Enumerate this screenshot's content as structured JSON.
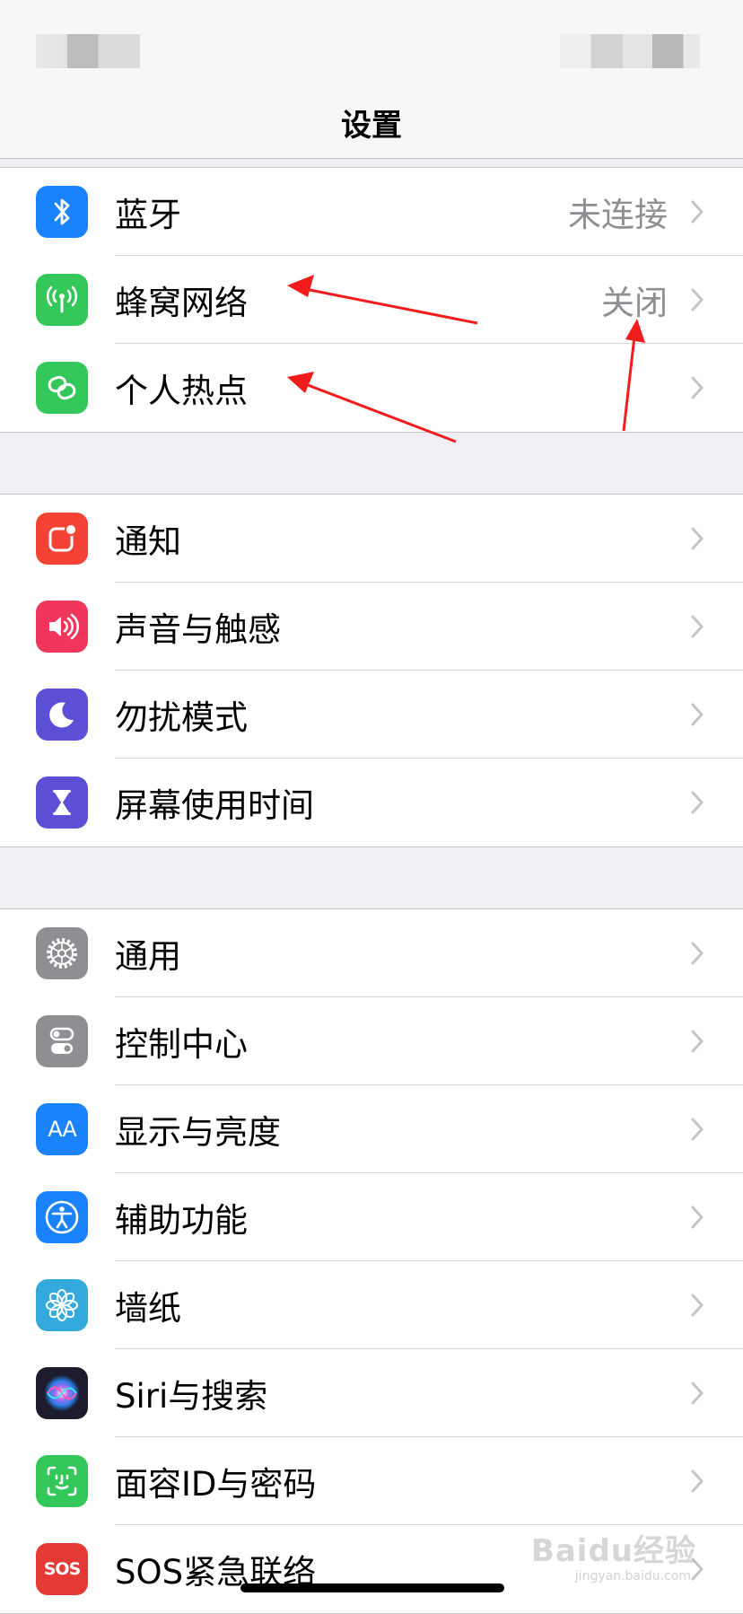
{
  "nav": {
    "title": "设置"
  },
  "groups": [
    {
      "rows": [
        {
          "name": "bluetooth",
          "label": "蓝牙",
          "value": "未连接",
          "icon": "bluetooth-icon",
          "color": "#1a82fb"
        },
        {
          "name": "cellular",
          "label": "蜂窝网络",
          "value": "关闭",
          "icon": "antenna-icon",
          "color": "#34c759"
        },
        {
          "name": "hotspot",
          "label": "个人热点",
          "value": "",
          "icon": "hotspot-link-icon",
          "color": "#34c759"
        }
      ]
    },
    {
      "rows": [
        {
          "name": "notifications",
          "label": "通知",
          "value": "",
          "icon": "notification-icon",
          "color": "#f44336"
        },
        {
          "name": "sounds",
          "label": "声音与触感",
          "value": "",
          "icon": "speaker-icon",
          "color": "#f0365a"
        },
        {
          "name": "do-not-disturb",
          "label": "勿扰模式",
          "value": "",
          "icon": "moon-icon",
          "color": "#5b4fd6"
        },
        {
          "name": "screen-time",
          "label": "屏幕使用时间",
          "value": "",
          "icon": "hourglass-icon",
          "color": "#5b4fd6"
        }
      ]
    },
    {
      "rows": [
        {
          "name": "general",
          "label": "通用",
          "value": "",
          "icon": "gear-icon",
          "color": "#8e8e93"
        },
        {
          "name": "control-center",
          "label": "控制中心",
          "value": "",
          "icon": "toggles-icon",
          "color": "#8e8e93"
        },
        {
          "name": "display",
          "label": "显示与亮度",
          "value": "",
          "icon": "text-size-icon",
          "color": "#1a82fb"
        },
        {
          "name": "accessibility",
          "label": "辅助功能",
          "value": "",
          "icon": "accessibility-icon",
          "color": "#1a82fb"
        },
        {
          "name": "wallpaper",
          "label": "墙纸",
          "value": "",
          "icon": "flower-icon",
          "color": "#34aadc"
        },
        {
          "name": "siri",
          "label": "Siri与搜索",
          "value": "",
          "icon": "siri-icon",
          "color": "#1c1c2e"
        },
        {
          "name": "face-id",
          "label": "面容ID与密码",
          "value": "",
          "icon": "face-id-icon",
          "color": "#34c759"
        },
        {
          "name": "emergency-sos",
          "label": "SOS紧急联络",
          "value": "",
          "icon": "sos-icon",
          "color": "#e53935"
        }
      ]
    }
  ],
  "icons": {
    "display_text": "AA",
    "sos_text": "SOS"
  },
  "watermark": {
    "text": "Baidu经验",
    "sub": "jingyan.baidu.com"
  }
}
